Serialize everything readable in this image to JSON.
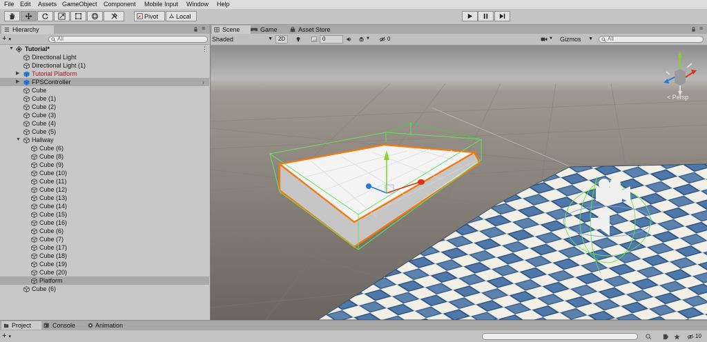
{
  "menu": [
    "File",
    "Edit",
    "Assets",
    "GameObject",
    "Component",
    "Mobile Input",
    "Window",
    "Help"
  ],
  "toolbar": {
    "tools": [
      "hand-tool",
      "move-tool",
      "rotate-tool",
      "scale-tool",
      "rect-tool",
      "transform-tool",
      "custom-tool"
    ],
    "pivot_label": "Pivot",
    "local_label": "Local"
  },
  "hierarchy": {
    "tab_label": "Hierarchy",
    "search_placeholder": "All",
    "scene_name": "Tutorial*",
    "items": [
      {
        "label": "Directional Light",
        "indent": 1,
        "type": "go"
      },
      {
        "label": "Directional Light (1)",
        "indent": 1,
        "type": "go"
      },
      {
        "label": "Tutorial Platform",
        "indent": 1,
        "type": "prefab",
        "color": "#b3141a",
        "arrow": true
      },
      {
        "label": "FPSController",
        "indent": 1,
        "type": "prefab",
        "arrow": true,
        "selected": true
      },
      {
        "label": "Cube",
        "indent": 1,
        "type": "go"
      },
      {
        "label": "Cube (1)",
        "indent": 1,
        "type": "go"
      },
      {
        "label": "Cube (2)",
        "indent": 1,
        "type": "go"
      },
      {
        "label": "Cube (3)",
        "indent": 1,
        "type": "go"
      },
      {
        "label": "Cube (4)",
        "indent": 1,
        "type": "go"
      },
      {
        "label": "Cube (5)",
        "indent": 1,
        "type": "go"
      },
      {
        "label": "Hallway",
        "indent": 1,
        "type": "go",
        "expanded": true
      },
      {
        "label": "Cube (6)",
        "indent": 2,
        "type": "go"
      },
      {
        "label": "Cube (8)",
        "indent": 2,
        "type": "go"
      },
      {
        "label": "Cube (9)",
        "indent": 2,
        "type": "go"
      },
      {
        "label": "Cube (10)",
        "indent": 2,
        "type": "go"
      },
      {
        "label": "Cube (11)",
        "indent": 2,
        "type": "go"
      },
      {
        "label": "Cube (12)",
        "indent": 2,
        "type": "go"
      },
      {
        "label": "Cube (13)",
        "indent": 2,
        "type": "go"
      },
      {
        "label": "Cube (14)",
        "indent": 2,
        "type": "go"
      },
      {
        "label": "Cube (15)",
        "indent": 2,
        "type": "go"
      },
      {
        "label": "Cube (16)",
        "indent": 2,
        "type": "go"
      },
      {
        "label": "Cube (6)",
        "indent": 2,
        "type": "go"
      },
      {
        "label": "Cube (7)",
        "indent": 2,
        "type": "go"
      },
      {
        "label": "Cube (17)",
        "indent": 2,
        "type": "go"
      },
      {
        "label": "Cube (18)",
        "indent": 2,
        "type": "go"
      },
      {
        "label": "Cube (19)",
        "indent": 2,
        "type": "go"
      },
      {
        "label": "Cube (20)",
        "indent": 2,
        "type": "go"
      },
      {
        "label": "Platform",
        "indent": 2,
        "type": "go",
        "selected": true
      },
      {
        "label": "Cube (6)",
        "indent": 1,
        "type": "go"
      }
    ]
  },
  "scene": {
    "tabs": [
      "Scene",
      "Game",
      "Asset Store"
    ],
    "shading_mode": "Shaded",
    "mode_2d": "2D",
    "effects_count": "0",
    "hidden_count": "0",
    "gizmos_label": "Gizmos",
    "search_placeholder": "All",
    "persp_label": "Persp"
  },
  "bottom": {
    "tabs": [
      "Project",
      "Console",
      "Animation"
    ],
    "hidden_count": "10"
  },
  "colors": {
    "selection_outline": "#f07a12",
    "bounds": "#66e35a",
    "axis_x": "#d9321c",
    "axis_y": "#8bd12a",
    "axis_z": "#2a78d8",
    "tile_blue": "#4d78a9"
  }
}
